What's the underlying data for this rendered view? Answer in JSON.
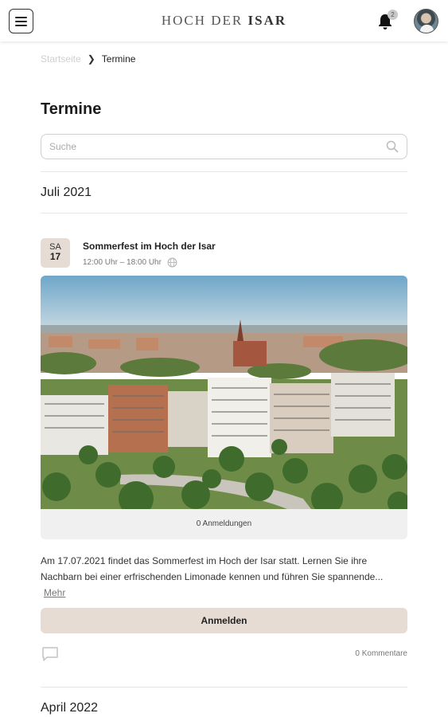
{
  "header": {
    "brand_light": "HOCH DER",
    "brand_bold": "ISAR",
    "notification_count": "2"
  },
  "breadcrumb": {
    "home": "Startseite",
    "current": "Termine"
  },
  "page": {
    "title": "Termine",
    "search_placeholder": "Suche"
  },
  "months": [
    {
      "label": "Juli 2021"
    },
    {
      "label": "April 2022"
    }
  ],
  "event": {
    "weekday": "SA",
    "day": "17",
    "title": "Sommerfest im Hoch der Isar",
    "time": "12:00 Uhr – 18:00 Uhr",
    "registrations": "0 Anmeldungen",
    "description": "Am 17.07.2021 findet das Sommerfest im Hoch der Isar statt. Lernen Sie ihre Nachbarn bei einer erfrischenden Limonade kennen und führen Sie spannende...",
    "more_label": "Mehr",
    "register_label": "Anmelden",
    "comments": "0 Kommentare"
  },
  "colors": {
    "accent": "#e6dcd3",
    "background": "#ffffff"
  },
  "icons": {
    "menu": "hamburger-icon",
    "notifications": "bell-icon",
    "search": "search-icon",
    "online": "globe-icon",
    "comments": "comment-icon"
  }
}
